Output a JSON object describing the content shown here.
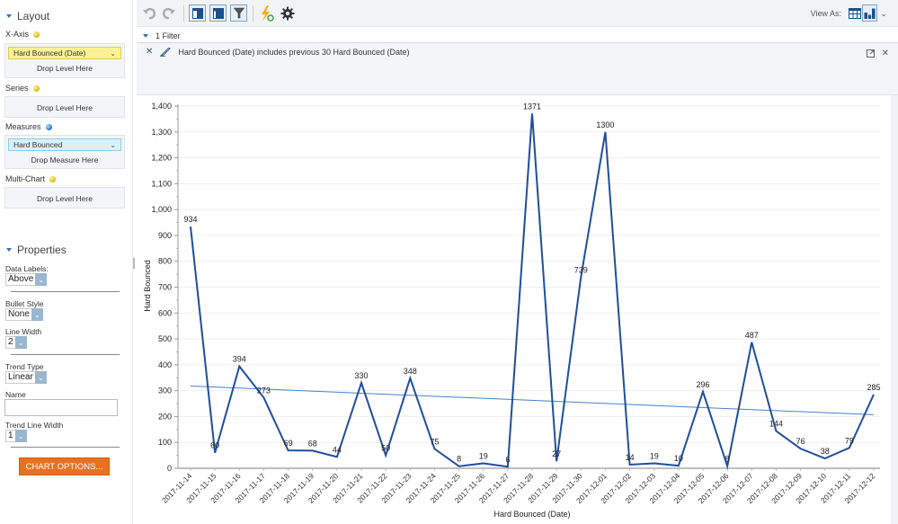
{
  "sidebar": {
    "layout_title": "Layout",
    "xaxis_label": "X-Axis",
    "xaxis_pill": "Hard Bounced (Date)",
    "xaxis_drop": "Drop Level Here",
    "series_label": "Series",
    "series_drop": "Drop Level Here",
    "measures_label": "Measures",
    "measures_pill": "Hard Bounced",
    "measures_drop": "Drop Measure Here",
    "multichart_label": "Multi-Chart",
    "multichart_drop": "Drop Level Here",
    "properties_title": "Properties",
    "data_labels_label": "Data Labels:",
    "data_labels_value": "Above",
    "bullet_style_label": "Bullet Style",
    "bullet_style_value": "None",
    "line_width_label": "Line Width",
    "line_width_value": "2",
    "trend_type_label": "Trend Type",
    "trend_type_value": "Linear",
    "name_label": "Name",
    "name_value": "",
    "trend_line_width_label": "Trend Line Width",
    "trend_line_width_value": "1",
    "chart_options_button": "CHART OPTIONS...",
    "chevron": "⌄"
  },
  "toolbar": {
    "undo_icon": "undo-icon",
    "redo_icon": "redo-icon",
    "view_as_label": "View As:"
  },
  "filter": {
    "count_label": "1 Filter",
    "text": "Hard Bounced (Date) includes previous 30 Hard Bounced (Date)",
    "remove_glyph": "✕",
    "close_glyph": "✕"
  },
  "colors": {
    "series_line": "#1f4e9c",
    "trend_line": "#4a7fd0",
    "accent_orange": "#e8711f"
  },
  "chart_data": {
    "type": "line",
    "title": "",
    "xlabel": "Hard Bounced (Date)",
    "ylabel": "Hard Bounced",
    "ylim": [
      0,
      1400
    ],
    "yticks": [
      0,
      100,
      200,
      300,
      400,
      500,
      600,
      700,
      800,
      900,
      1000,
      1100,
      1200,
      1300,
      1400
    ],
    "ytick_labels": [
      "0",
      "100",
      "200",
      "300",
      "400",
      "500",
      "600",
      "700",
      "800",
      "900",
      "1,000",
      "1,100",
      "1,200",
      "1,300",
      "1,400"
    ],
    "grid": true,
    "legend": "none",
    "categories": [
      "2017-11-14",
      "2017-11-15",
      "2017-11-16",
      "2017-11-17",
      "2017-11-18",
      "2017-11-19",
      "2017-11-20",
      "2017-11-21",
      "2017-11-22",
      "2017-11-23",
      "2017-11-24",
      "2017-11-25",
      "2017-11-26",
      "2017-11-27",
      "2017-11-28",
      "2017-11-29",
      "2017-11-30",
      "2017-12-01",
      "2017-12-02",
      "2017-12-03",
      "2017-12-04",
      "2017-12-05",
      "2017-12-06",
      "2017-12-07",
      "2017-12-08",
      "2017-12-09",
      "2017-12-10",
      "2017-12-11",
      "2017-12-12"
    ],
    "series": [
      {
        "name": "Hard Bounced",
        "values": [
          934,
          60,
          394,
          273,
          69,
          68,
          44,
          330,
          50,
          348,
          75,
          8,
          19,
          6,
          1371,
          27,
          739,
          1300,
          14,
          19,
          10,
          296,
          8,
          487,
          144,
          76,
          38,
          79,
          285
        ],
        "data_labels": "above"
      }
    ],
    "trendline": {
      "type": "linear",
      "start_value": 318,
      "end_value": 207
    }
  }
}
